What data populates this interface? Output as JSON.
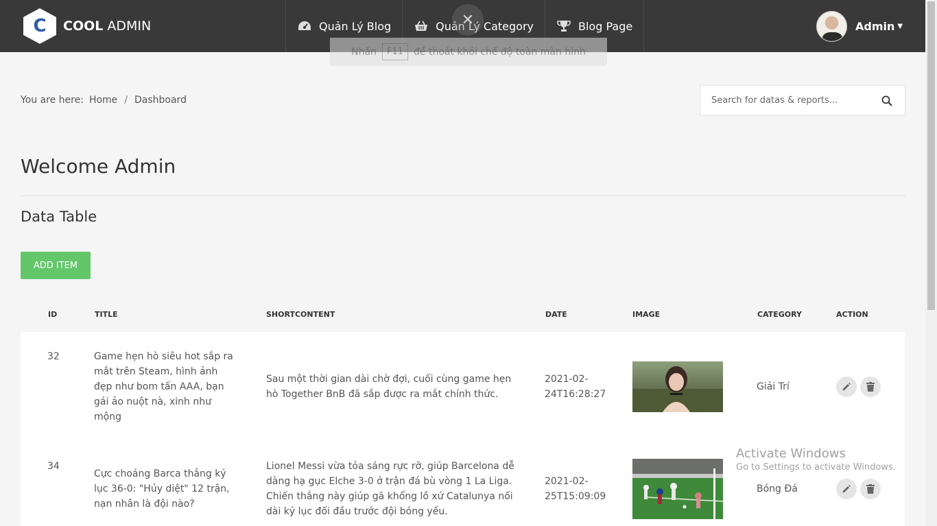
{
  "brand": {
    "bold": "COOL",
    "light": "ADMIN",
    "logo_letter": "C"
  },
  "nav": [
    {
      "label": "Quản Lý Blog",
      "icon": "dashboard-icon"
    },
    {
      "label": "Quản Lý Category",
      "icon": "basket-icon"
    },
    {
      "label": "Blog Page",
      "icon": "trophy-icon"
    }
  ],
  "user": {
    "name": "Admin"
  },
  "fullscreen_notice": {
    "prefix": "Nhấn",
    "key": "F11",
    "suffix": "để thoát khỏi chế độ toàn màn hình"
  },
  "breadcrumb": {
    "prefix": "You are here:",
    "home": "Home",
    "sep": "/",
    "current": "Dashboard"
  },
  "search": {
    "placeholder": "Search for datas & reports..."
  },
  "welcome": "Welcome Admin",
  "section_title": "Data Table",
  "add_button": "ADD ITEM",
  "table": {
    "columns": [
      "ID",
      "TITLE",
      "SHORTCONTENT",
      "DATE",
      "IMAGE",
      "CATEGORY",
      "ACTION"
    ],
    "rows": [
      {
        "id": "32",
        "title": "Game hẹn hò siêu hot sắp ra mắt trên Steam, hình ảnh đẹp như bom tấn AAA, bạn gái ảo nuột nà, xinh như mộng",
        "shortcontent": "Sau một thời gian dài chờ đợi, cuối cùng game hẹn hò Together BnB đã sắp được ra mắt chính thức.",
        "date": "2021-02-24T16:28:27",
        "category": "Giải Trí"
      },
      {
        "id": "34",
        "title": "Cực choáng Barca thắng kỷ lục 36-0: \"Hủy diệt\" 12 trận, nạn nhân là đội nào?",
        "shortcontent": "Lionel Messi vừa tỏa sáng rực rỡ, giúp Barcelona dễ dàng hạ gục Elche 3-0 ở trận đá bù vòng 1 La Liga. Chiến thắng này giúp gã khổng lồ xứ Catalunya nối dài kỷ lục đối đầu trước đội bóng yếu.",
        "date": "2021-02-25T15:09:09",
        "category": "Bóng Đá"
      }
    ]
  },
  "watermark": {
    "title": "Activate Windows",
    "subtitle": "Go to Settings to activate Windows."
  },
  "colors": {
    "header": "#393939",
    "accent_green": "#63c76a",
    "background": "#f5f5f5"
  }
}
